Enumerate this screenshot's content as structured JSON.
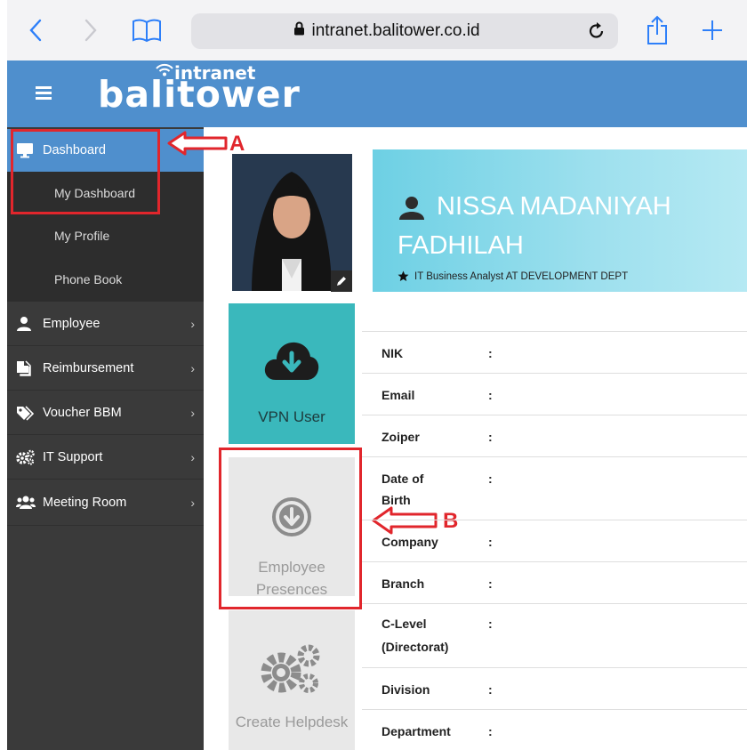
{
  "browser": {
    "url": "intranet.balitower.co.id"
  },
  "header": {
    "logo_main": "balitower",
    "logo_sub": "intranet"
  },
  "sidebar": {
    "dashboard": "Dashboard",
    "sub_items": [
      "My Dashboard",
      "My Profile",
      "Phone Book"
    ],
    "menu": [
      {
        "label": "Employee",
        "icon": "user-icon"
      },
      {
        "label": "Reimbursement",
        "icon": "document-icon"
      },
      {
        "label": "Voucher BBM",
        "icon": "tags-icon"
      },
      {
        "label": "IT Support",
        "icon": "cogs-icon"
      },
      {
        "label": "Meeting Room",
        "icon": "users-icon"
      }
    ]
  },
  "tiles": {
    "vpn": "VPN User",
    "presences_l1": "Employee",
    "presences_l2": "Presences",
    "helpdesk": "Create Helpdesk"
  },
  "profile": {
    "name_line1": "NISSA MADANIYAH",
    "name_line2": "FADHILAH",
    "subtitle": "IT Business Analyst AT DEVELOPMENT DEPT",
    "fields": [
      {
        "label": "NIK"
      },
      {
        "label": "Email"
      },
      {
        "label": "Zoiper"
      },
      {
        "label": "Date of",
        "label2": "Birth"
      },
      {
        "label": "Company"
      },
      {
        "label": "Branch"
      },
      {
        "label": "C-Level",
        "label2": "(Directorat)"
      },
      {
        "label": "Division"
      },
      {
        "label": "Department"
      }
    ],
    "separator": ":"
  },
  "annotations": {
    "a": "A",
    "b": "B",
    "color": "#e1262c"
  },
  "colors": {
    "header": "#4f8fcd",
    "sidebar": "#3a3a3a",
    "vpn_tile": "#3ab8bc",
    "banner": "#6dd0e4"
  }
}
